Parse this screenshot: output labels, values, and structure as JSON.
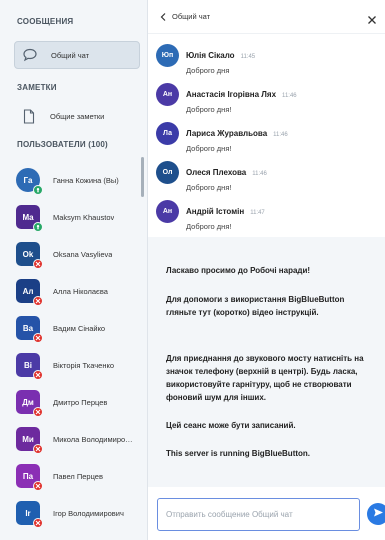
{
  "sidebar": {
    "messages_title": "СООБЩЕНИЯ",
    "public_chat_label": "Общий чат",
    "notes_title": "ЗАМЕТКИ",
    "shared_notes_label": "Общие заметки",
    "users_title": "ПОЛЬЗОВАТЕЛИ (100)",
    "users": [
      {
        "initials": "Га",
        "name": "Ганна Кожина (Вы)",
        "color": "#2d6bb5",
        "round": true,
        "status": "green"
      },
      {
        "initials": "Ma",
        "name": "Maksym Khaustov",
        "color": "#4f2a8f",
        "round": false,
        "status": "green"
      },
      {
        "initials": "Ok",
        "name": "Oksana Vasylieva",
        "color": "#1e4f8c",
        "round": false,
        "status": "red"
      },
      {
        "initials": "Ал",
        "name": "Алла Ніколаєва",
        "color": "#1b3f86",
        "round": false,
        "status": "red"
      },
      {
        "initials": "Ва",
        "name": "Вадим Сінайко",
        "color": "#2553a8",
        "round": false,
        "status": "red"
      },
      {
        "initials": "Ві",
        "name": "Вікторія Ткаченко",
        "color": "#4b3aa6",
        "round": false,
        "status": "red"
      },
      {
        "initials": "Дм",
        "name": "Дмитро Перцев",
        "color": "#7a2fb0",
        "round": false,
        "status": "red"
      },
      {
        "initials": "Ми",
        "name": "Микола Володимирович",
        "color": "#6d2a9e",
        "round": false,
        "status": "red"
      },
      {
        "initials": "Па",
        "name": "Павел Перцев",
        "color": "#8b2fb5",
        "round": false,
        "status": "red"
      },
      {
        "initials": "Ir",
        "name": "Ігор Володимирович",
        "color": "#1f5fb0",
        "round": false,
        "status": "red"
      }
    ]
  },
  "chat": {
    "title": "Общий чат",
    "messages": [
      {
        "initials": "Юп",
        "name": "Юлія Сікало",
        "time": "11:45",
        "text": "Доброго дня",
        "color": "#2d6bb5"
      },
      {
        "initials": "Ан",
        "name": "Анастасія Ігорівна Лях",
        "time": "11:46",
        "text": "Доброго дня!",
        "color": "#4b3aa6"
      },
      {
        "initials": "Ла",
        "name": "Лариса Журавльова",
        "time": "11:46",
        "text": "Доброго дня!",
        "color": "#3b3ba8"
      },
      {
        "initials": "Ол",
        "name": "Олеся Плехова",
        "time": "11:46",
        "text": "Доброго дня!",
        "color": "#1e4f8c"
      },
      {
        "initials": "Ан",
        "name": "Андрій Істомін",
        "time": "11:47",
        "text": "Доброго дня!",
        "color": "#4b3aa6"
      }
    ],
    "welcome": {
      "p1": "Ласкаво просимо до Робочі наради!",
      "p2": "Для допомоги з використання BigBlueButton гляньте тут (коротко) відео інструкцій.",
      "p3": "Для приєднання до звукового мосту натисніть на значок телефону (верхній в центрі). Будь ласка, використовуйте гарнітуру, щоб не створювати фоновий шум для інших.",
      "p4": "Цей сеанс може бути записаний.",
      "p5": "This server is running BigBlueButton."
    },
    "input_placeholder": "Отправить сообщение Общий чат"
  }
}
